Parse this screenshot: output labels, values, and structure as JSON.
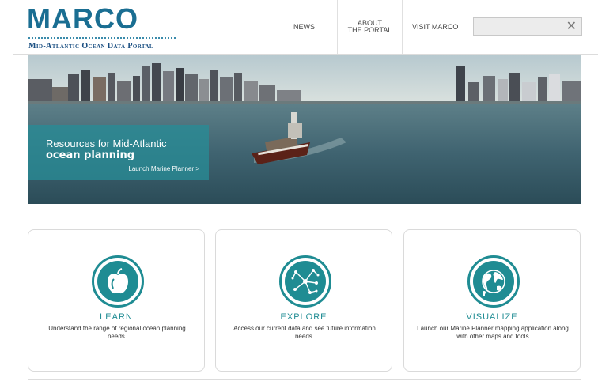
{
  "logo": {
    "wordmark": "MARCO",
    "tagline": "Mid-Atlantic Ocean Data Portal"
  },
  "nav": {
    "news": "NEWS",
    "about_line1": "ABOUT",
    "about_line2": "THE PORTAL",
    "visit": "VISIT MARCO"
  },
  "search": {
    "value": "",
    "clear_glyph": "✕"
  },
  "hero": {
    "line1": "Resources for Mid-Atlantic",
    "line2": "ocean planning",
    "link": "Launch Marine Planner >"
  },
  "cards": [
    {
      "title": "LEARN",
      "description": "Understand the range of regional ocean planning needs.",
      "icon": "apple-icon"
    },
    {
      "title": "EXPLORE",
      "description": "Access our current data and see future information needs.",
      "icon": "network-icon"
    },
    {
      "title": "VISUALIZE",
      "description": "Launch our Marine Planner mapping application along with other maps and tools",
      "icon": "globe-icon"
    }
  ],
  "colors": {
    "brand": "#1a6e92",
    "accent": "#1f8c93"
  }
}
